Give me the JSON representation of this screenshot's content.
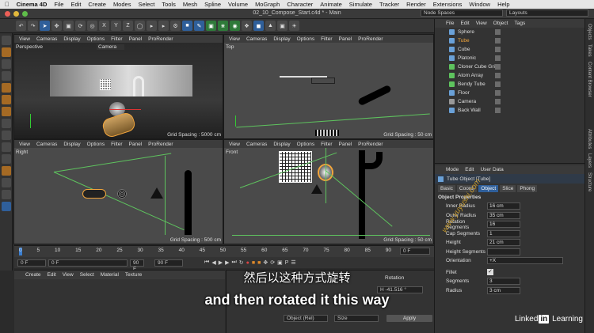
{
  "menubar": {
    "apple": "",
    "app": "Cinema 4D",
    "items": [
      "File",
      "Edit",
      "Create",
      "Modes",
      "Select",
      "Tools",
      "Mesh",
      "Spline",
      "Volume",
      "MoGraph",
      "Character",
      "Animate",
      "Simulate",
      "Tracker",
      "Render",
      "Extensions",
      "Window",
      "Help"
    ]
  },
  "window": {
    "title": "02_10_Compose_Start.c4d * - Main",
    "node_spaces": "Node Spaces",
    "layouts": "Layouts"
  },
  "toolbar": {
    "axis_x": "X",
    "axis_y": "Y",
    "axis_z": "Z"
  },
  "viewport_menu": [
    "View",
    "Cameras",
    "Display",
    "Options",
    "Filter",
    "Panel",
    "ProRender"
  ],
  "viewports": {
    "perspective": {
      "name": "Perspective",
      "camera": "Camera",
      "grid": "Grid Spacing : 5000 cm"
    },
    "top": {
      "name": "Top",
      "grid": "Grid Spacing : 50 cm"
    },
    "right": {
      "name": "Right",
      "grid": "Grid Spacing : 500 cm"
    },
    "front": {
      "name": "Front",
      "grid": "Grid Spacing : 50 cm"
    }
  },
  "object_manager": {
    "menu": [
      "File",
      "Edit",
      "View",
      "Object",
      "Tags"
    ],
    "objects": [
      {
        "name": "Sphere",
        "selected": false
      },
      {
        "name": "Tube",
        "selected": true
      },
      {
        "name": "Cube",
        "selected": false
      },
      {
        "name": "Platonic",
        "selected": false
      },
      {
        "name": "Cloner Cube Grid",
        "selected": false
      },
      {
        "name": "Atom Array",
        "selected": false
      },
      {
        "name": "Bendy Tube",
        "selected": false
      },
      {
        "name": "Floor",
        "selected": false
      },
      {
        "name": "Camera",
        "selected": false
      },
      {
        "name": "Back Wall",
        "selected": false
      }
    ]
  },
  "side_tabs": [
    "Objects",
    "Takes",
    "Content Browser",
    "Attributes",
    "Layers",
    "Structure"
  ],
  "attributes": {
    "menu": [
      "Mode",
      "Edit",
      "User Data"
    ],
    "object_title": "Tube Object [Tube]",
    "tabs": [
      "Basic",
      "Coord.",
      "Object",
      "Slice",
      "Phong"
    ],
    "active_tab": "Object",
    "section": "Object Properties",
    "props": [
      {
        "label": "Inner Radius",
        "value": "16 cm"
      },
      {
        "label": "Outer Radius",
        "value": "35 cm"
      },
      {
        "label": "Rotation Segments",
        "value": "16"
      },
      {
        "label": "Cap Segments",
        "value": "1"
      },
      {
        "label": "Height",
        "value": "21 cm"
      },
      {
        "label": "Height Segments",
        "value": ""
      },
      {
        "label": "Orientation",
        "value": "+X"
      }
    ],
    "fillet_label": "Fillet",
    "fillet_props": [
      {
        "label": "Segments",
        "value": "3"
      },
      {
        "label": "Radius",
        "value": "3 cm"
      }
    ]
  },
  "timeline": {
    "ticks": [
      "0",
      "5",
      "10",
      "15",
      "20",
      "25",
      "30",
      "35",
      "40",
      "45",
      "50",
      "55",
      "60",
      "65",
      "70",
      "75",
      "80",
      "85",
      "90"
    ],
    "current_frame": "0 F",
    "start": "0 F",
    "min": "0 F",
    "max": "90 F",
    "end": "90 F",
    "fps": "0 F"
  },
  "material_manager": {
    "menu": [
      "Create",
      "Edit",
      "View",
      "Select",
      "Material",
      "Texture"
    ]
  },
  "coordinates": {
    "rotation_label": "Rotation",
    "h_value": "H  -41.516 °",
    "mode": "Object (Rel)",
    "size_mode": "Size",
    "apply": "Apply"
  },
  "subtitle": {
    "zh": "然后以这种方式旋转",
    "en": "and then rotated it this way"
  },
  "brand": {
    "part1": "Linked",
    "part2": "in",
    "part3": " Learning"
  },
  "watermark": "www.yuyushi.com"
}
